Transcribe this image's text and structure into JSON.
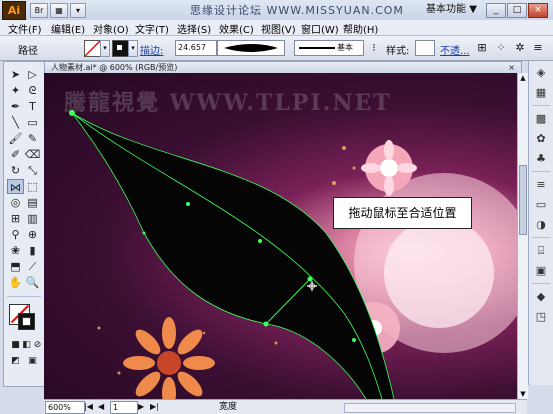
{
  "app": {
    "logo": "Ai",
    "title": "思缘设计论坛 WWW.MISSYUAN.COM",
    "workspace": "基本功能",
    "workspace_arrow": "▼",
    "window_buttons": [
      "_",
      "□",
      "×"
    ]
  },
  "menu": [
    "文件(F)",
    "编辑(E)",
    "对象(O)",
    "文字(T)",
    "选择(S)",
    "效果(C)",
    "视图(V)",
    "窗口(W)",
    "帮助(H)"
  ],
  "control_bar": {
    "label": "路径",
    "stroke_label": "描边:",
    "stroke_value": "24.657",
    "brush_label": "基本",
    "style_label": "样式:",
    "opacity_label": "不透..."
  },
  "document_tab": {
    "title": "人物素材.ai* @ 600% (RGB/预览)",
    "close": "×"
  },
  "canvas": {
    "watermark": "騰龍視覺 WWW.TLPI.NET",
    "tooltip": "拖动鼠标至合适位置"
  },
  "status_bar": {
    "zoom": "600%",
    "page": "1",
    "tool": "宽度",
    "first": "|◀",
    "prev": "◀",
    "next": "▶",
    "last": "▶|"
  },
  "colors": {
    "accent": "#1b3fa8",
    "path_anchor": "#3cff5a",
    "shape_fill": "#050505"
  }
}
